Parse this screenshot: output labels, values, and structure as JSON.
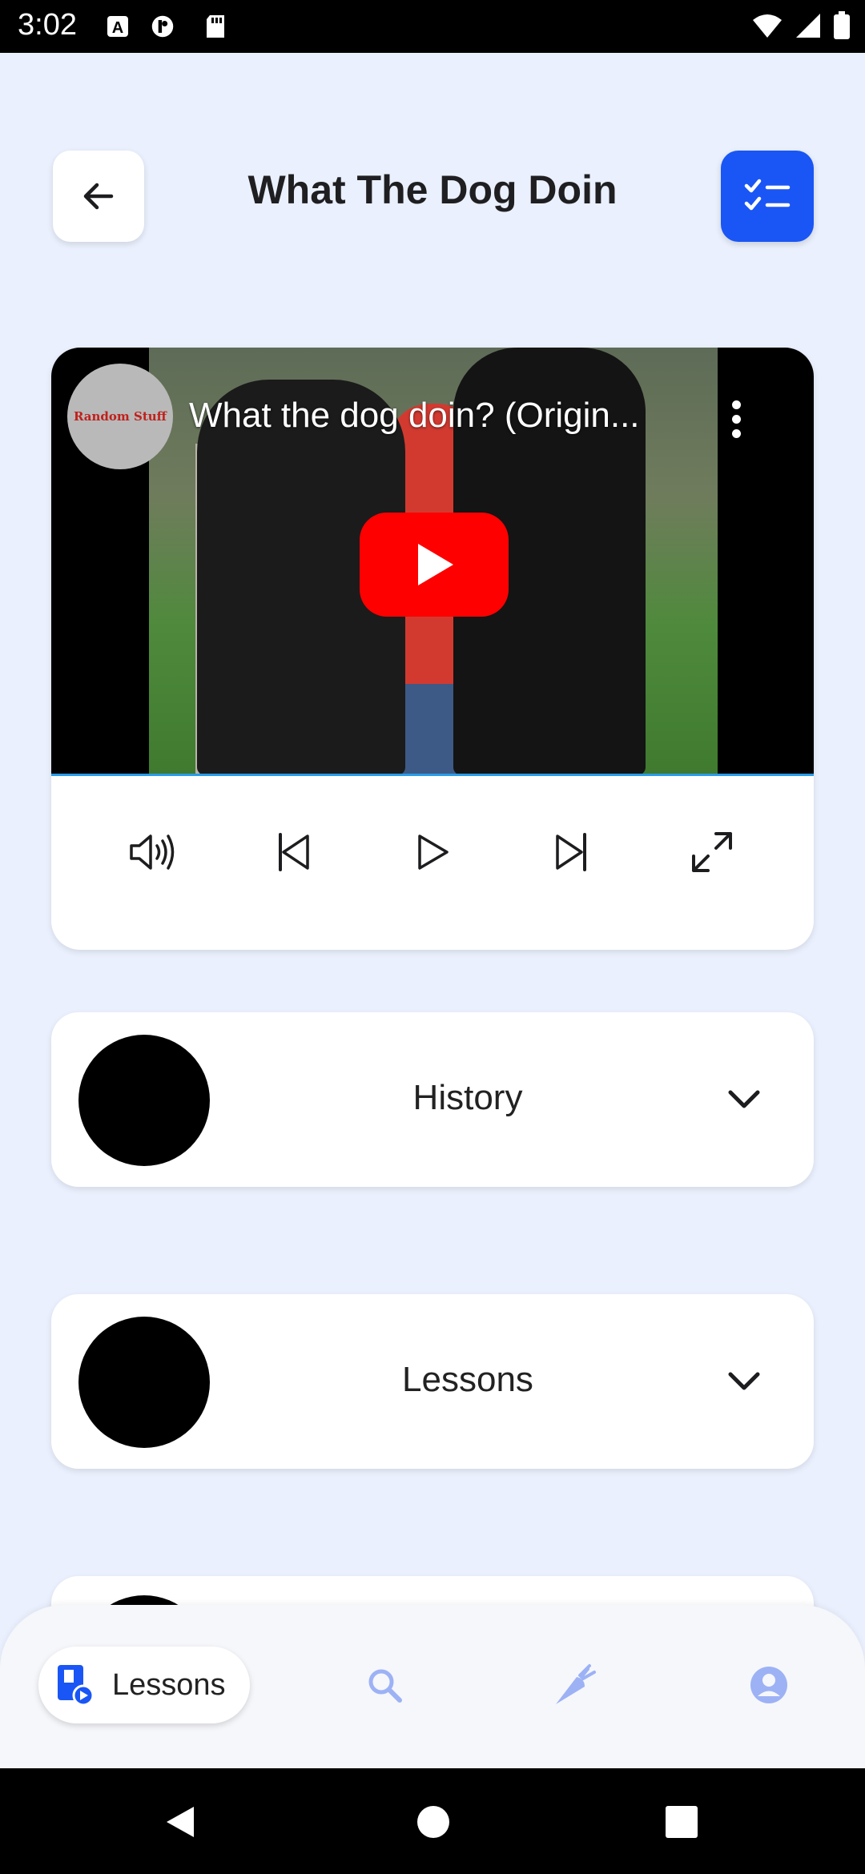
{
  "status_bar": {
    "time": "3:02",
    "icons": [
      "notification-a-icon",
      "notification-p-icon",
      "sd-card-icon",
      "wifi-icon",
      "signal-icon",
      "battery-icon"
    ]
  },
  "header": {
    "title": "What The Dog Doin",
    "back_icon": "arrow-left-icon",
    "action_icon": "checklist-icon",
    "accent_color": "#1a56f5"
  },
  "video": {
    "channel_name": "Random Stuff",
    "title": "What the dog doin? (Origin...",
    "controls": [
      "volume-icon",
      "skip-previous-icon",
      "play-icon",
      "skip-next-icon",
      "fullscreen-icon"
    ]
  },
  "sections": [
    {
      "label": "History"
    },
    {
      "label": "Lessons"
    }
  ],
  "bottom_nav": {
    "active_label": "Lessons",
    "items": [
      "lessons-icon",
      "search-icon",
      "carrot-icon",
      "profile-icon"
    ],
    "inactive_color": "#9db2f5"
  }
}
